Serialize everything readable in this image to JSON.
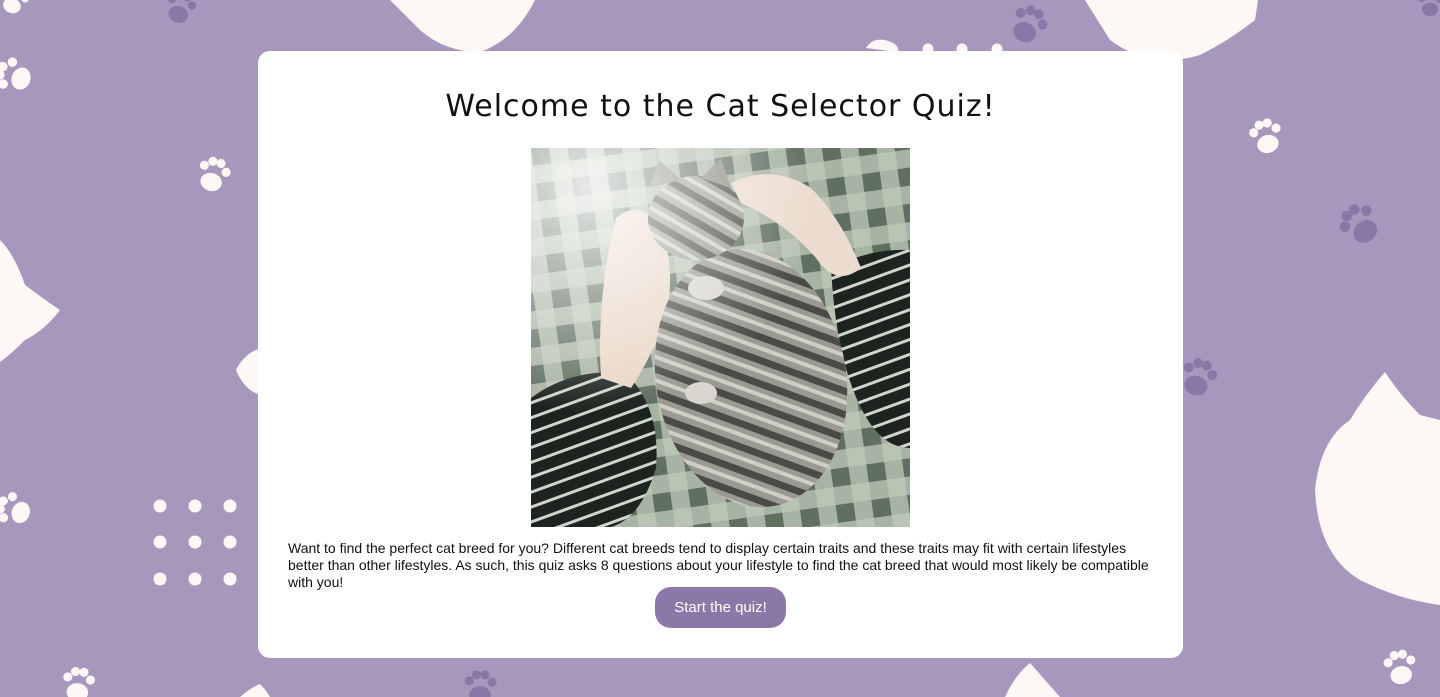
{
  "page": {
    "title": "Welcome to the Cat Selector Quiz!",
    "description": "Want to find the perfect cat breed for you? Different cat breeds tend to display certain traits and these traits may fit with certain lifestyles better than other lifestyles. As such, this quiz asks 8 questions about your lifestyle to find the cat breed that would most likely be compatible with you!",
    "start_button_label": "Start the quiz!"
  },
  "colors": {
    "background": "#a797bd",
    "pattern_light": "#fdf8f5",
    "pattern_dark": "#8a77a6",
    "card": "#ffffff",
    "button": "#8c78a8",
    "button_text": "#ffffff"
  },
  "icons": {
    "background_pattern": "paw-print-icon",
    "cat_head_shapes": "cat-head-icon"
  }
}
